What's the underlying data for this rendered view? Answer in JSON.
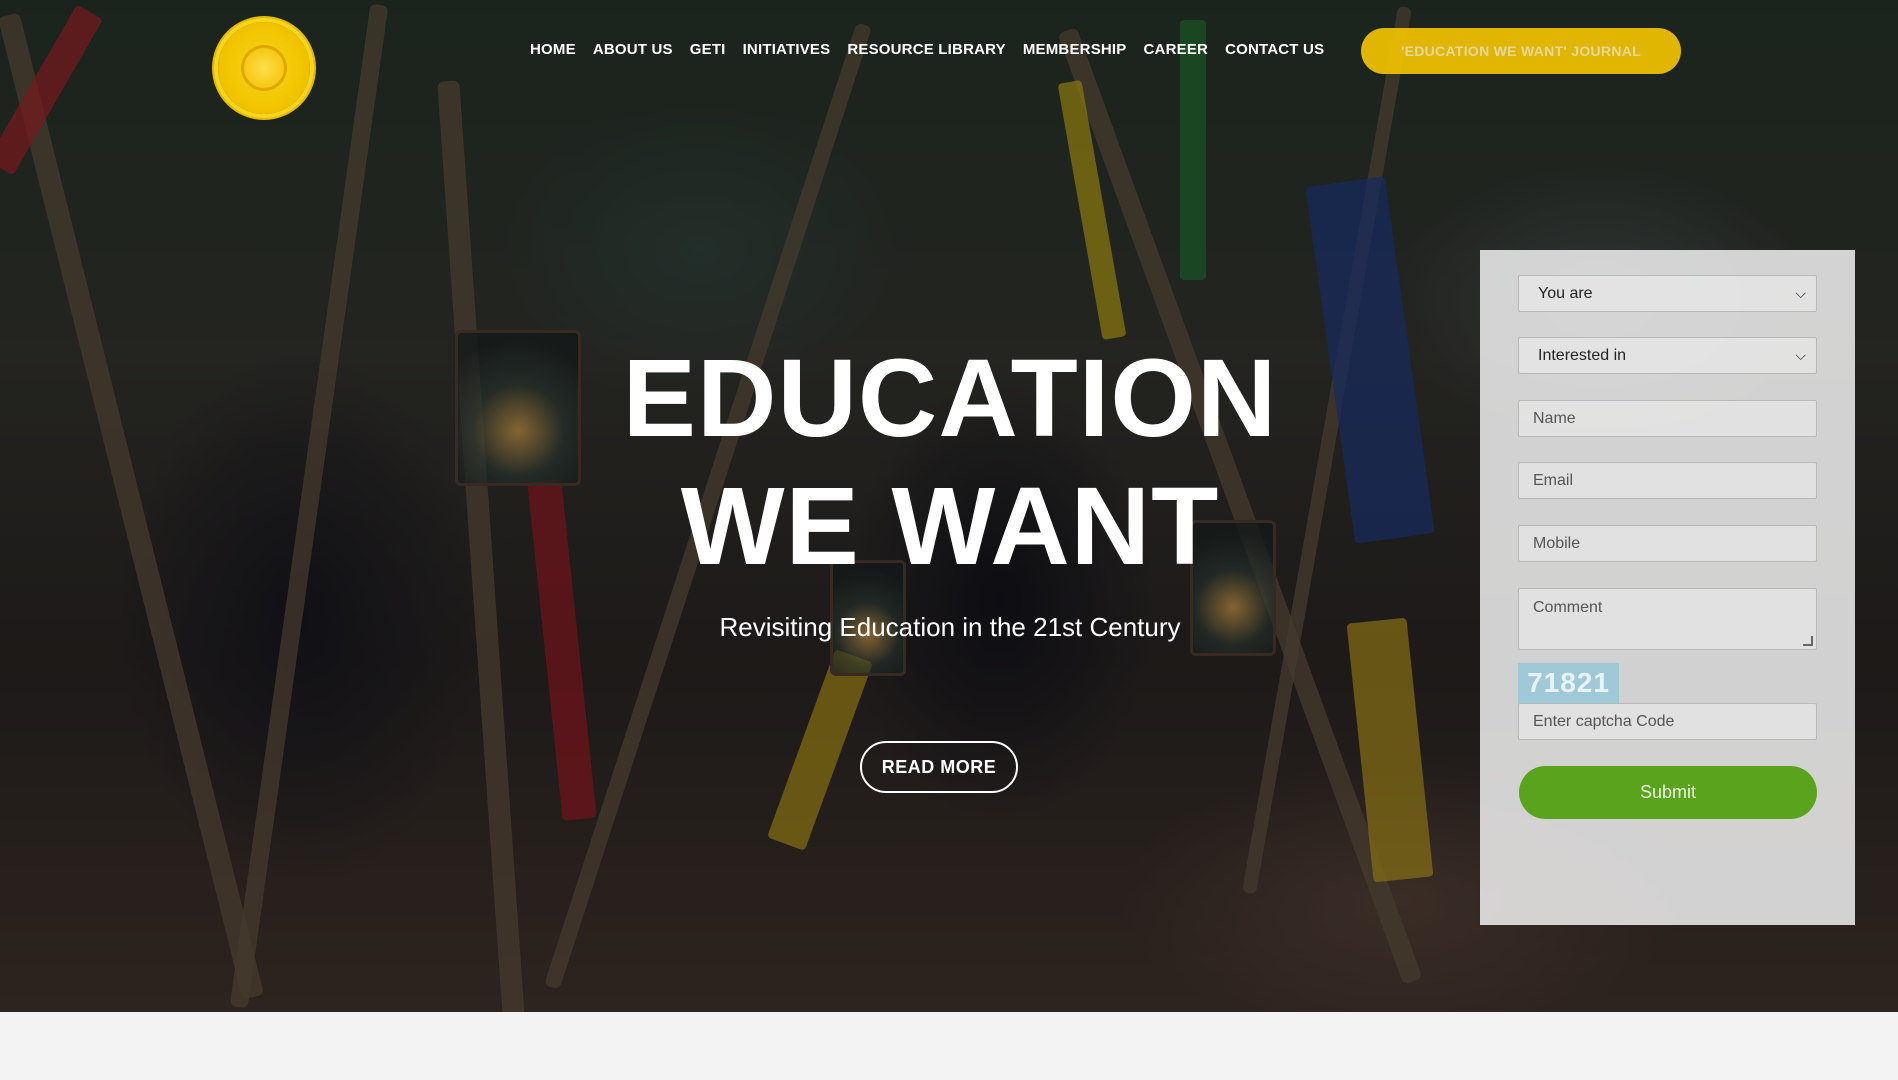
{
  "nav": {
    "items": [
      {
        "label": "HOME"
      },
      {
        "label": "ABOUT US"
      },
      {
        "label": "GETI"
      },
      {
        "label": "INITIATIVES"
      },
      {
        "label": "RESOURCE LIBRARY"
      },
      {
        "label": "MEMBERSHIP"
      },
      {
        "label": "CAREER"
      },
      {
        "label": "CONTACT US"
      }
    ],
    "journal_button": "'EDUCATION WE WANT' JOURNAL"
  },
  "hero": {
    "title_line1": "EDUCATION",
    "title_line2": "WE WANT",
    "subtitle": "Revisiting Education in the 21st Century",
    "read_more": "READ MORE"
  },
  "form": {
    "you_are": "You are",
    "interested_in": "Interested in",
    "name_placeholder": "Name",
    "email_placeholder": "Email",
    "mobile_placeholder": "Mobile",
    "comment_placeholder": "Comment",
    "captcha_code": "71821",
    "captcha_placeholder": "Enter captcha Code",
    "submit_label": "Submit"
  },
  "colors": {
    "accent_yellow": "#f2c300",
    "submit_green": "#5aa41d",
    "captcha_blue": "#9fc9d6"
  }
}
